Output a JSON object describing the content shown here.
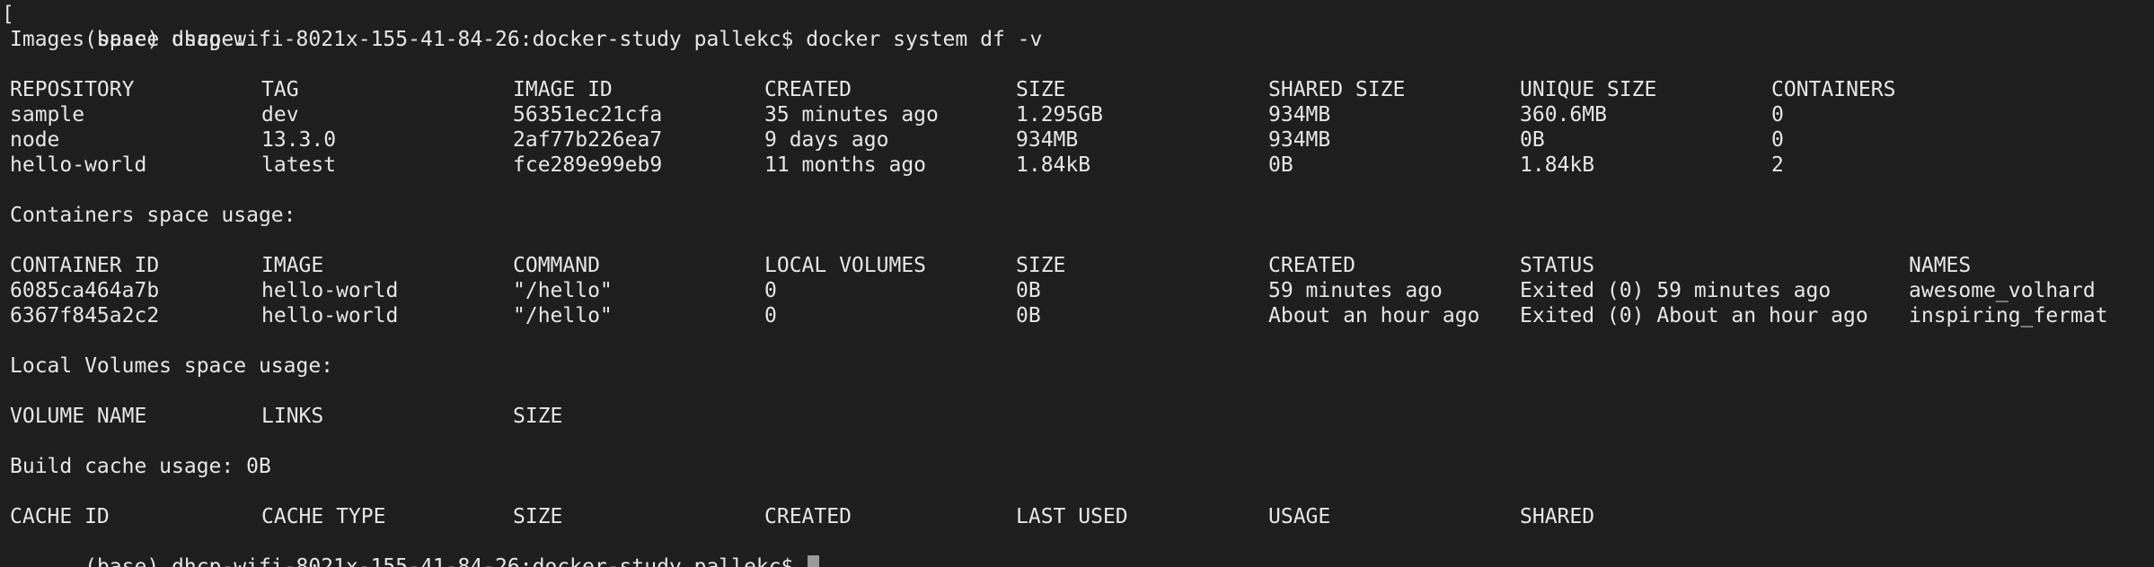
{
  "terminal": {
    "background": "#1e1e1e",
    "foreground": "#e6e6e6",
    "first_prompt": "(base) dhcp-wifi-8021x-155-41-84-26:docker-study pallekc$ ",
    "first_command": "docker system df -v",
    "final_prompt": "(base) dhcp-wifi-8021x-155-41-84-26:docker-study pallekc$ "
  },
  "images": {
    "heading": "Images space usage:",
    "columns": [
      "REPOSITORY",
      "TAG",
      "IMAGE ID",
      "CREATED",
      "SIZE",
      "SHARED SIZE",
      "UNIQUE SIZE",
      "CONTAINERS"
    ],
    "rows": [
      [
        "sample",
        "dev",
        "56351ec21cfa",
        "35 minutes ago",
        "1.295GB",
        "934MB",
        "360.6MB",
        "0"
      ],
      [
        "node",
        "13.3.0",
        "2af77b226ea7",
        "9 days ago",
        "934MB",
        "934MB",
        "0B",
        "0"
      ],
      [
        "hello-world",
        "latest",
        "fce289e99eb9",
        "11 months ago",
        "1.84kB",
        "0B",
        "1.84kB",
        "2"
      ]
    ]
  },
  "containers": {
    "heading": "Containers space usage:",
    "columns": [
      "CONTAINER ID",
      "IMAGE",
      "COMMAND",
      "LOCAL VOLUMES",
      "SIZE",
      "CREATED",
      "STATUS",
      "NAMES"
    ],
    "rows": [
      [
        "6085ca464a7b",
        "hello-world",
        "\"/hello\"",
        "0",
        "0B",
        "59 minutes ago",
        "Exited (0) 59 minutes ago",
        "awesome_volhard"
      ],
      [
        "6367f845a2c2",
        "hello-world",
        "\"/hello\"",
        "0",
        "0B",
        "About an hour ago",
        "Exited (0) About an hour ago",
        "inspiring_fermat"
      ]
    ]
  },
  "volumes": {
    "heading": "Local Volumes space usage:",
    "columns": [
      "VOLUME NAME",
      "LINKS",
      "SIZE"
    ]
  },
  "build_cache": {
    "heading": "Build cache usage: 0B",
    "columns": [
      "CACHE ID",
      "CACHE TYPE",
      "SIZE",
      "CREATED",
      "LAST USED",
      "USAGE",
      "SHARED"
    ]
  }
}
